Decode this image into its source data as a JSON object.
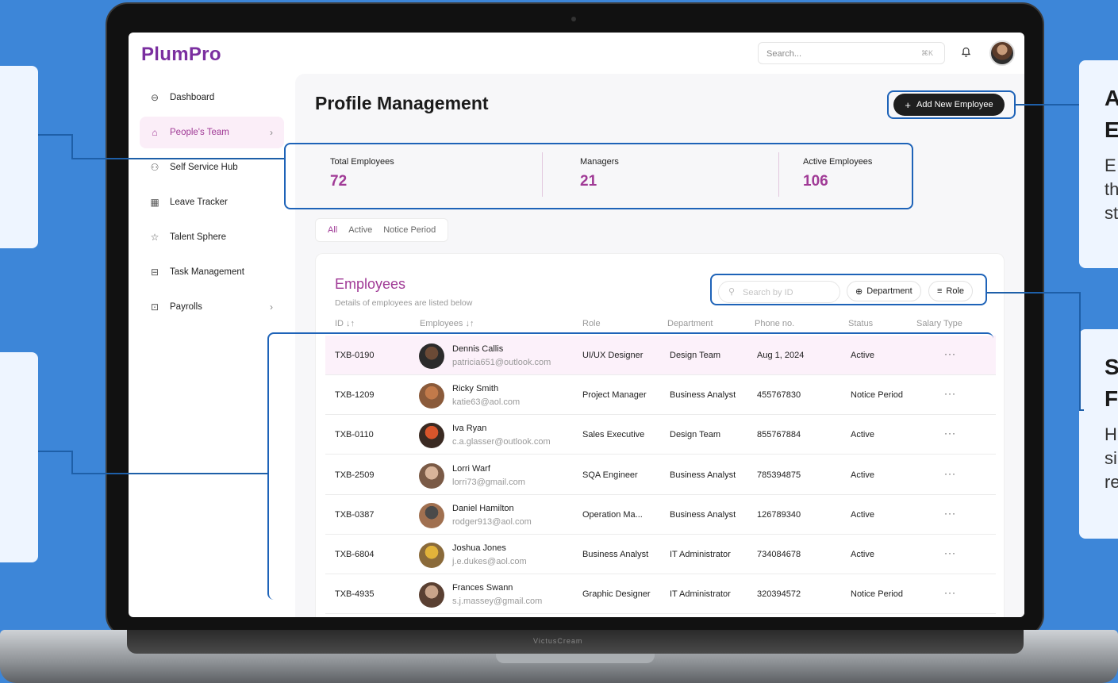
{
  "app": {
    "logo": "PlumPro"
  },
  "topbar": {
    "search_placeholder": "Search...",
    "search_shortcut": "⌘K",
    "bell_icon": "bell-icon"
  },
  "sidebar": {
    "items": [
      {
        "label": "Dashboard",
        "icon": "inbox-icon",
        "glyph": "⊖",
        "active": false
      },
      {
        "label": "People's Team",
        "icon": "home-icon",
        "glyph": "⌂",
        "active": true,
        "chevron": "›"
      },
      {
        "label": "Self Service Hub",
        "icon": "users-icon",
        "glyph": "⚇",
        "active": false
      },
      {
        "label": "Leave Tracker",
        "icon": "calendar-icon",
        "glyph": "▦",
        "active": false
      },
      {
        "label": "Talent Sphere",
        "icon": "star-icon",
        "glyph": "☆",
        "active": false
      },
      {
        "label": "Task Management",
        "icon": "archive-icon",
        "glyph": "⊟",
        "active": false
      },
      {
        "label": "Payrolls",
        "icon": "receipt-icon",
        "glyph": "⊡",
        "active": false,
        "chevron": "›"
      }
    ]
  },
  "page": {
    "title": "Profile Management",
    "add_button": "Add New Employee"
  },
  "stats": [
    {
      "label": "Total Employees",
      "value": "72"
    },
    {
      "label": "Managers",
      "value": "21"
    },
    {
      "label": "Active Employees",
      "value": "106"
    }
  ],
  "tabs": [
    "All",
    "Active",
    "Notice Period"
  ],
  "employees_card": {
    "title": "Employees",
    "subtitle": "Details of employees are listed below",
    "id_search_placeholder": "Search by ID",
    "department_button": "Department",
    "role_button": "Role",
    "columns": [
      "ID ↓↑",
      "Employees ↓↑",
      "Role",
      "Department",
      "Phone no.",
      "Status",
      "Salary Type"
    ],
    "rows": [
      {
        "id": "TXB-0190",
        "name": "Dennis Callis",
        "email": "patricia651@outlook.com",
        "role": "UI/UX Designer",
        "department": "Design Team",
        "phone": "Aug 1, 2024",
        "status": "Active",
        "more": "···"
      },
      {
        "id": "TXB-1209",
        "name": "Ricky Smith",
        "email": "katie63@aol.com",
        "role": "Project Manager",
        "department": "Business Analyst",
        "phone": "455767830",
        "status": "Notice Period",
        "more": "···"
      },
      {
        "id": "TXB-0110",
        "name": "Iva Ryan",
        "email": "c.a.glasser@outlook.com",
        "role": "Sales Executive",
        "department": "Design Team",
        "phone": "855767884",
        "status": "Active",
        "more": "···"
      },
      {
        "id": "TXB-2509",
        "name": "Lorri Warf",
        "email": "lorri73@gmail.com",
        "role": "SQA Engineer",
        "department": "Business Analyst",
        "phone": "785394875",
        "status": "Active",
        "more": "···"
      },
      {
        "id": "TXB-0387",
        "name": "Daniel Hamilton",
        "email": "rodger913@aol.com",
        "role": "Operation Ma...",
        "department": "Business Analyst",
        "phone": "126789340",
        "status": "Active",
        "more": "···"
      },
      {
        "id": "TXB-6804",
        "name": "Joshua Jones",
        "email": "j.e.dukes@aol.com",
        "role": "Business Analyst",
        "department": "IT Administrator",
        "phone": "734084678",
        "status": "Active",
        "more": "···"
      },
      {
        "id": "TXB-4935",
        "name": "Frances Swann",
        "email": "s.j.massey@gmail.com",
        "role": "Graphic Designer",
        "department": "IT Administrator",
        "phone": "320394572",
        "status": "Notice Period",
        "more": "···"
      }
    ]
  },
  "annotations": {
    "right_top": {
      "title": "A\nE",
      "body": "E\nth\nst"
    },
    "right_bottom": {
      "title": "S\nF",
      "body": "H\nsi\nre"
    }
  },
  "laptop_brand": "VictusCream"
}
